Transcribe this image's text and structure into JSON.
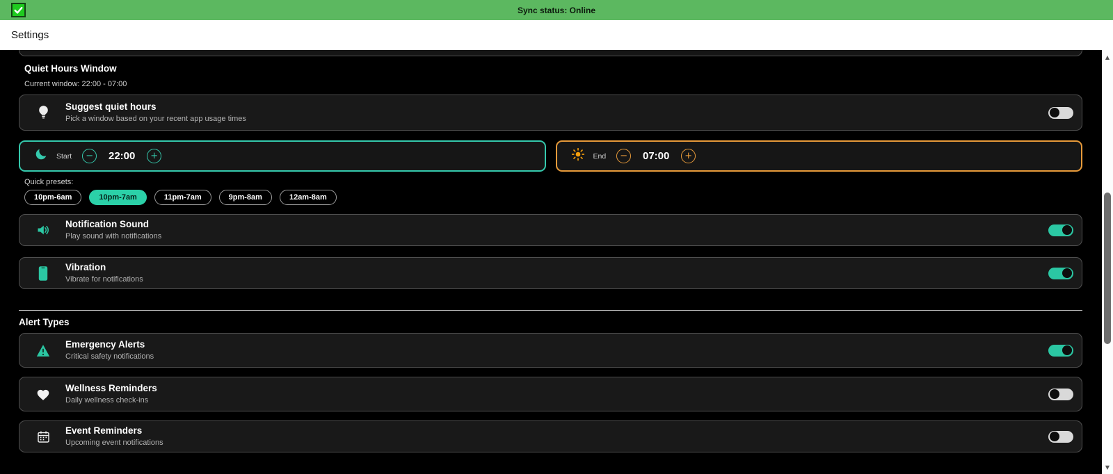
{
  "colors": {
    "sync_bar_green": "#5cb860",
    "accent_teal": "#2bc7a3",
    "accent_orange": "#e79a3a",
    "toggle_off_track": "#d9d9d9",
    "card_background": "#191919",
    "page_background": "#000000"
  },
  "sync_bar": {
    "status_text": "Sync status: Online",
    "icon": "green-checkbox-icon"
  },
  "title_bar": {
    "title": "Settings"
  },
  "quiet_hours": {
    "section_title": "Quiet Hours Window",
    "current_window_text": "Current window: 22:00 - 07:00",
    "suggest": {
      "title": "Suggest quiet hours",
      "subtitle": "Pick a window based on your recent app usage times",
      "icon": "lightbulb-icon",
      "enabled": false
    },
    "start": {
      "label": "Start",
      "value": "22:00",
      "icon": "moon-icon"
    },
    "end": {
      "label": "End",
      "value": "07:00",
      "icon": "sun-icon"
    },
    "presets_label": "Quick presets:",
    "presets": [
      {
        "label": "10pm-6am",
        "selected": false
      },
      {
        "label": "10pm-7am",
        "selected": true
      },
      {
        "label": "11pm-7am",
        "selected": false
      },
      {
        "label": "9pm-8am",
        "selected": false
      },
      {
        "label": "12am-8am",
        "selected": false
      }
    ]
  },
  "general_toggles": [
    {
      "title": "Notification Sound",
      "subtitle": "Play sound with notifications",
      "icon": "speaker-icon",
      "enabled": true
    },
    {
      "title": "Vibration",
      "subtitle": "Vibrate for notifications",
      "icon": "phone-icon",
      "enabled": true
    }
  ],
  "alert_types": {
    "section_title": "Alert Types",
    "items": [
      {
        "title": "Emergency Alerts",
        "subtitle": "Critical safety notifications",
        "icon": "warning-triangle-icon",
        "enabled": true
      },
      {
        "title": "Wellness Reminders",
        "subtitle": "Daily wellness check-ins",
        "icon": "heart-icon",
        "enabled": false
      },
      {
        "title": "Event Reminders",
        "subtitle": "Upcoming event notifications",
        "icon": "calendar-icon",
        "enabled": false
      }
    ]
  },
  "controls": {
    "minus": "−",
    "plus": "+"
  },
  "scrollbar": {
    "up_arrow": "▲",
    "down_arrow": "▼"
  }
}
